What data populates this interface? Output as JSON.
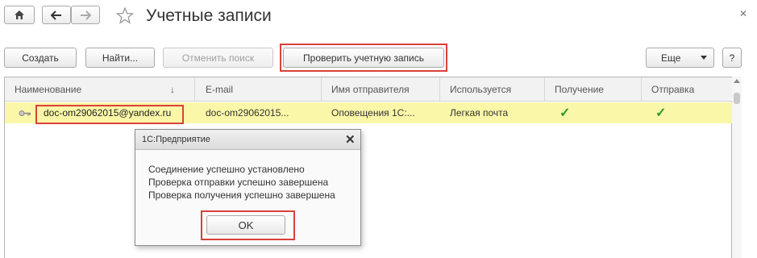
{
  "toolbar_top": {
    "home_icon": "home-icon",
    "back_icon": "arrow-left-icon",
    "forward_icon": "arrow-right-icon",
    "star_icon": "star-icon",
    "title": "Учетные записи",
    "close_icon": "close-icon"
  },
  "actions": {
    "create": "Создать",
    "find": "Найти...",
    "cancel_search": "Отменить поиск",
    "check_account": "Проверить учетную запись",
    "more": "Еще",
    "help": "?"
  },
  "table": {
    "columns": [
      "Наименование",
      "E-mail",
      "Имя отправителя",
      "Используется",
      "Получение",
      "Отправка"
    ],
    "sort_indicator": "↓",
    "rows": [
      {
        "name": "doc-om29062015@yandex.ru",
        "email": "doc-om29062015...",
        "sender": "Оповещения 1С:...",
        "used": "Легкая почта",
        "receive": "✓",
        "send": "✓"
      }
    ]
  },
  "dialog": {
    "title": "1С:Предприятие",
    "lines": [
      "Соединение успешно установлено",
      "Проверка отправки успешно завершена",
      "Проверка получения успешно завершена"
    ],
    "ok": "OK"
  },
  "colors": {
    "highlight_row": "#fbf7a9",
    "annotation_red": "#d9413a",
    "check_green": "#2a9b2a"
  }
}
